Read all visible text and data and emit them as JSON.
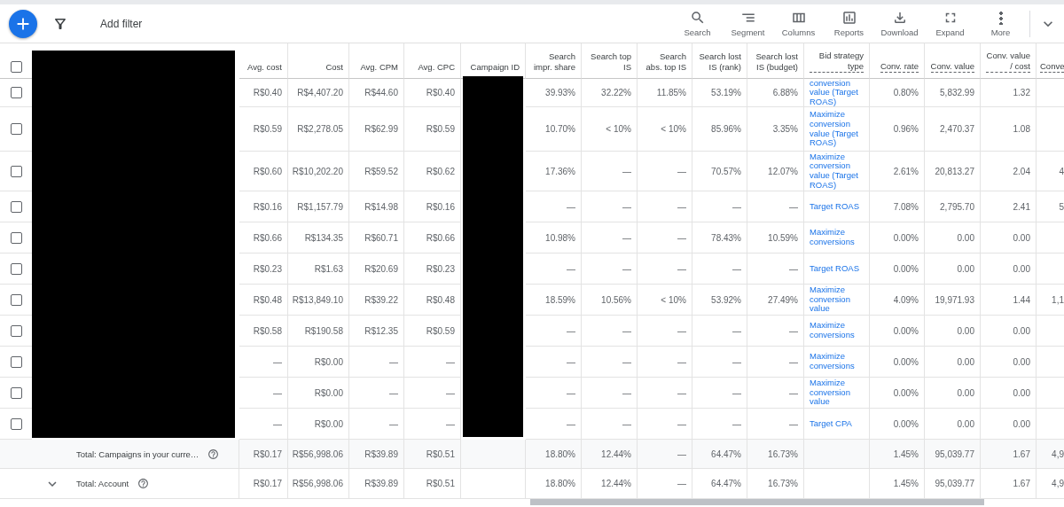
{
  "toolbar": {
    "add_filter": "Add filter",
    "actions": [
      {
        "kind": "search",
        "label": "Search"
      },
      {
        "kind": "segment",
        "label": "Segment"
      },
      {
        "kind": "columns",
        "label": "Columns"
      },
      {
        "kind": "reports",
        "label": "Reports"
      },
      {
        "kind": "download",
        "label": "Download"
      },
      {
        "kind": "expand",
        "label": "Expand"
      },
      {
        "kind": "more",
        "label": "More"
      }
    ]
  },
  "table": {
    "redacted": true,
    "header_checked": false,
    "columns": [
      {
        "label": "Avg. cost",
        "dotted": false
      },
      {
        "label": "Cost",
        "dotted": false
      },
      {
        "label": "Avg. CPM",
        "dotted": false
      },
      {
        "label": "Avg. CPC",
        "dotted": false
      },
      {
        "label": "Campaign ID",
        "dotted": false
      },
      {
        "label": "Search impr. share",
        "dotted": false
      },
      {
        "label": "Search top IS",
        "dotted": false
      },
      {
        "label": "Search abs. top IS",
        "dotted": false
      },
      {
        "label": "Search lost IS (rank)",
        "dotted": false
      },
      {
        "label": "Search lost IS (budget)",
        "dotted": false
      },
      {
        "label": "Bid strategy type",
        "dotted": true
      },
      {
        "label": "Conv. rate",
        "dotted": true
      },
      {
        "label": "Conv. value",
        "dotted": true
      },
      {
        "label": "Conv. value / cost",
        "dotted": true
      },
      {
        "label": "Conve",
        "dotted": true
      }
    ],
    "rows": [
      {
        "checked": false,
        "metrics": [
          "R$0.40",
          "R$4,407.20",
          "R$44.60",
          "R$0.40"
        ],
        "search": [
          "39.93%",
          "32.22%",
          "11.85%",
          "53.19%",
          "6.88%"
        ],
        "bid_strategy": "conversion value (Target ROAS)",
        "conversions": [
          "0.80%",
          "5,832.99",
          "1.32"
        ]
      },
      {
        "checked": false,
        "metrics": [
          "R$0.59",
          "R$2,278.05",
          "R$62.99",
          "R$0.59"
        ],
        "search": [
          "10.70%",
          "< 10%",
          "< 10%",
          "85.96%",
          "3.35%"
        ],
        "bid_strategy": "Maximize conversion value (Target ROAS)",
        "conversions": [
          "0.96%",
          "2,470.37",
          "1.08"
        ]
      },
      {
        "checked": false,
        "metrics": [
          "R$0.60",
          "R$10,202.20",
          "R$59.52",
          "R$0.62"
        ],
        "search": [
          "17.36%",
          "—",
          "—",
          "70.57%",
          "12.07%"
        ],
        "bid_strategy": "Maximize conversion value (Target ROAS)",
        "conversions": [
          "2.61%",
          "20,813.27",
          "2.04",
          "4"
        ]
      },
      {
        "checked": false,
        "metrics": [
          "R$0.16",
          "R$1,157.79",
          "R$14.98",
          "R$0.16"
        ],
        "search": [
          "—",
          "—",
          "—",
          "—",
          "—"
        ],
        "bid_strategy": "Target ROAS",
        "conversions": [
          "7.08%",
          "2,795.70",
          "2.41",
          "5"
        ]
      },
      {
        "checked": false,
        "metrics": [
          "R$0.66",
          "R$134.35",
          "R$60.71",
          "R$0.66"
        ],
        "search": [
          "10.98%",
          "—",
          "—",
          "78.43%",
          "10.59%"
        ],
        "bid_strategy": "Maximize conversions",
        "conversions": [
          "0.00%",
          "0.00",
          "0.00"
        ]
      },
      {
        "checked": false,
        "metrics": [
          "R$0.23",
          "R$1.63",
          "R$20.69",
          "R$0.23"
        ],
        "search": [
          "—",
          "—",
          "—",
          "—",
          "—"
        ],
        "bid_strategy": "Target ROAS",
        "conversions": [
          "0.00%",
          "0.00",
          "0.00"
        ]
      },
      {
        "checked": false,
        "metrics": [
          "R$0.48",
          "R$13,849.10",
          "R$39.22",
          "R$0.48"
        ],
        "search": [
          "18.59%",
          "10.56%",
          "< 10%",
          "53.92%",
          "27.49%"
        ],
        "bid_strategy": "Maximize conversion value",
        "conversions": [
          "4.09%",
          "19,971.93",
          "1.44",
          "1,1"
        ]
      },
      {
        "checked": false,
        "metrics": [
          "R$0.58",
          "R$190.58",
          "R$12.35",
          "R$0.59"
        ],
        "search": [
          "—",
          "—",
          "—",
          "—",
          "—"
        ],
        "bid_strategy": "Maximize conversions",
        "conversions": [
          "0.00%",
          "0.00",
          "0.00"
        ]
      },
      {
        "checked": false,
        "metrics": [
          "—",
          "R$0.00",
          "—",
          "—"
        ],
        "search": [
          "—",
          "—",
          "—",
          "—",
          "—"
        ],
        "bid_strategy": "Maximize conversions",
        "conversions": [
          "0.00%",
          "0.00",
          "0.00"
        ]
      },
      {
        "checked": false,
        "metrics": [
          "—",
          "R$0.00",
          "—",
          "—"
        ],
        "search": [
          "—",
          "—",
          "—",
          "—",
          "—"
        ],
        "bid_strategy": "Maximize conversion value",
        "conversions": [
          "0.00%",
          "0.00",
          "0.00"
        ]
      },
      {
        "checked": false,
        "metrics": [
          "—",
          "R$0.00",
          "—",
          "—"
        ],
        "search": [
          "—",
          "—",
          "—",
          "—",
          "—"
        ],
        "bid_strategy": "Target CPA",
        "conversions": [
          "0.00%",
          "0.00",
          "0.00"
        ]
      }
    ],
    "totals": [
      {
        "label": "Total: Campaigns in your curre…",
        "expandable": false,
        "metrics": [
          "R$0.17",
          "R$56,998.06",
          "R$39.89",
          "R$0.51"
        ],
        "search": [
          "18.80%",
          "12.44%",
          "—",
          "64.47%",
          "16.73%"
        ],
        "conversions": [
          "1.45%",
          "95,039.77",
          "1.67",
          "4,9"
        ]
      },
      {
        "label": "Total: Account",
        "expandable": true,
        "metrics": [
          "R$0.17",
          "R$56,998.06",
          "R$39.89",
          "R$0.51"
        ],
        "search": [
          "18.80%",
          "12.44%",
          "—",
          "64.47%",
          "16.73%"
        ],
        "conversions": [
          "1.45%",
          "95,039.77",
          "1.67",
          "4,9"
        ]
      }
    ]
  }
}
